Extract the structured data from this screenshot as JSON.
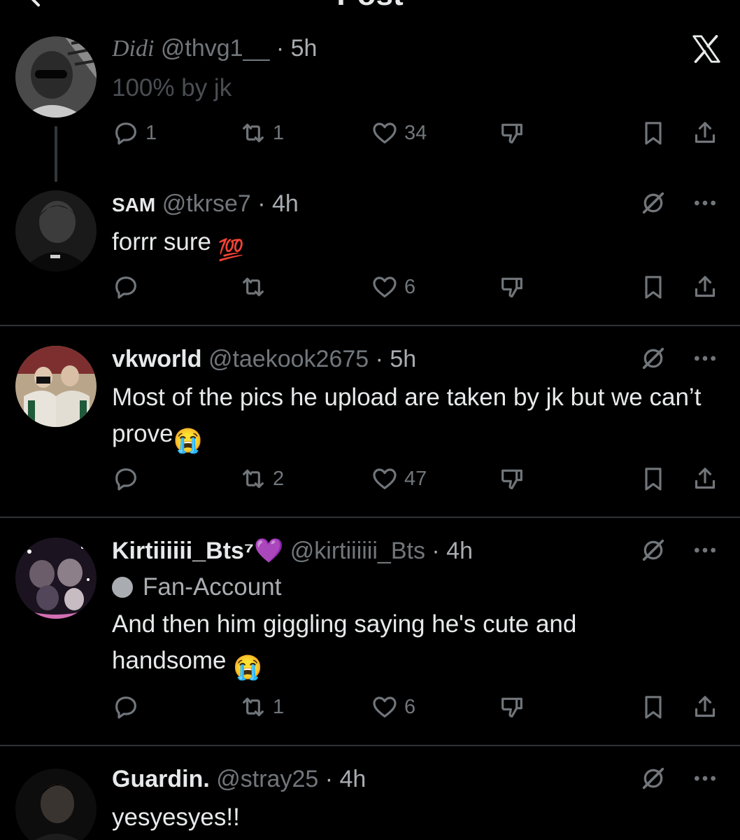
{
  "header": {
    "title": "Post"
  },
  "tweets": [
    {
      "name": "Didi",
      "handle": "@thvg1__",
      "time": "· 5h",
      "text": "100% by jk",
      "replies": "1",
      "reposts": "1",
      "likes": "34"
    },
    {
      "name": "SAM",
      "handle": "@tkrse7",
      "time": "· 4h",
      "text": "forrr sure",
      "emoji": "💯",
      "replies": "",
      "reposts": "",
      "likes": "6"
    },
    {
      "name": "vkworld",
      "handle": "@taekook2675",
      "time": "· 5h",
      "text": "Most of the pics he upload are taken by jk but we can’t prove",
      "emoji": "😭",
      "replies": "",
      "reposts": "2",
      "likes": "47"
    },
    {
      "name": "Kirtiiiiii_Bts⁷💜",
      "handle": "@kirtiiiiii_Bts",
      "time": "· 4h",
      "label": "Fan-Account",
      "text": "And then him giggling saying he's cute and handsome",
      "emoji": "😭",
      "replies": "",
      "reposts": "1",
      "likes": "6"
    },
    {
      "name": "Guardin.",
      "handle": "@stray25",
      "time": "· 4h",
      "text": "yesyesyes!!"
    }
  ],
  "icons": {
    "reply": "reply-icon",
    "repost": "repost-icon",
    "like": "heart-icon",
    "dislike": "dislike-icon",
    "bookmark": "bookmark-icon",
    "share": "share-icon",
    "grok": "grok-icon",
    "more": "more-icon",
    "logo": "x-logo-icon"
  },
  "colors": {
    "background": "#000000",
    "text": "#e7e9ea",
    "muted": "#71767b",
    "divider": "#2f3336"
  }
}
